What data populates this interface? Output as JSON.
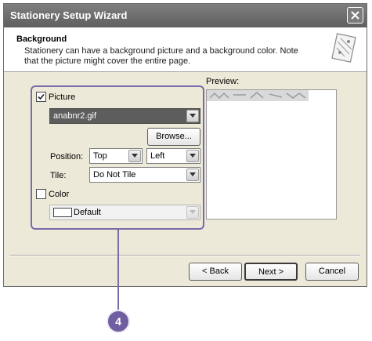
{
  "window": {
    "title": "Stationery Setup Wizard"
  },
  "header": {
    "title": "Background",
    "description": "Stationery can have a background picture and a background color. Note that the picture might cover the entire page."
  },
  "picture": {
    "checkbox_label": "Picture",
    "checked": true,
    "file_value": "anabnr2.gif",
    "browse_label": "Browse...",
    "position_label": "Position:",
    "position_vertical": "Top",
    "position_horizontal": "Left",
    "tile_label": "Tile:",
    "tile_value": "Do Not Tile"
  },
  "color": {
    "checkbox_label": "Color",
    "checked": false,
    "value": "Default"
  },
  "preview": {
    "label": "Preview:"
  },
  "footer": {
    "back_label": "< Back",
    "next_label": "Next >",
    "cancel_label": "Cancel"
  },
  "callout": {
    "number": "4",
    "color": "#6f5fa0"
  }
}
